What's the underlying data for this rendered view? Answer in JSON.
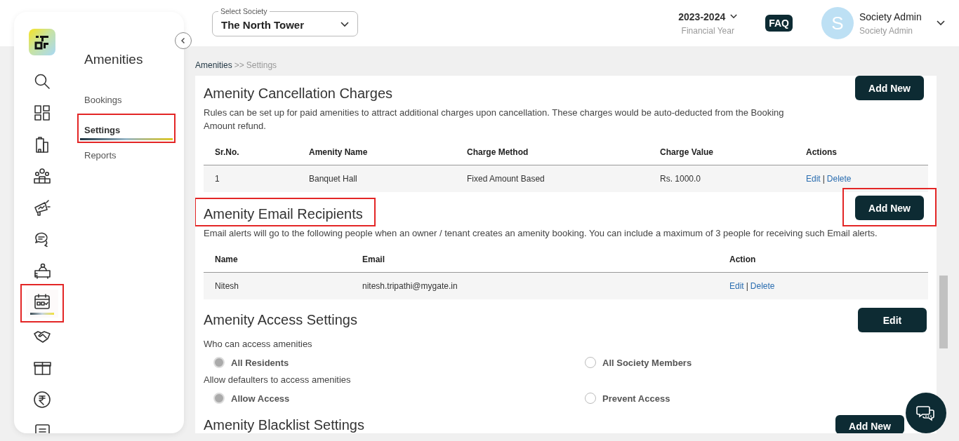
{
  "header": {
    "society_select": {
      "label": "Select Society",
      "value": "The North Tower"
    },
    "financial_year": {
      "value": "2023-2024",
      "label": "Financial Year"
    },
    "faq": "FAQ",
    "user": {
      "initial": "S",
      "name": "Society Admin",
      "role": "Society Admin"
    }
  },
  "rail": {
    "items": [
      {
        "selected": false,
        "highlighted": false
      },
      {
        "selected": false,
        "highlighted": false
      },
      {
        "selected": false,
        "highlighted": false
      },
      {
        "selected": false,
        "highlighted": false
      },
      {
        "selected": false,
        "highlighted": false
      },
      {
        "selected": false,
        "highlighted": false
      },
      {
        "selected": false,
        "highlighted": false
      },
      {
        "selected": true,
        "highlighted": true
      },
      {
        "selected": false,
        "highlighted": false
      },
      {
        "selected": false,
        "highlighted": false
      },
      {
        "selected": false,
        "highlighted": false
      },
      {
        "selected": false,
        "highlighted": false
      }
    ]
  },
  "submenu": {
    "title": "Amenities",
    "items": [
      {
        "label": "Bookings",
        "selected": false,
        "highlighted": false
      },
      {
        "label": "Settings",
        "selected": true,
        "highlighted": true
      },
      {
        "label": "Reports",
        "selected": false,
        "highlighted": false
      }
    ]
  },
  "breadcrumb": {
    "parent": "Amenities",
    "separator": ">>",
    "current": "Settings"
  },
  "sections": [
    {
      "kind": "table",
      "title": "Amenity Cancellation Charges",
      "highlighted": false,
      "button": {
        "label": "Add New",
        "highlighted": false
      },
      "description": "Rules can be set up for paid amenities to attract additional charges upon cancellation. These charges would be auto-deducted from the Booking Amount refund.",
      "narrow": true,
      "columns": [
        "Sr.No.",
        "Amenity Name",
        "Charge Method",
        "Charge Value",
        "Actions"
      ],
      "rows": [
        {
          "cells": [
            "1",
            "Banquet Hall",
            "Fixed Amount Based",
            "Rs. 1000.0"
          ],
          "actions": [
            "Edit",
            "Delete"
          ],
          "separator": "|"
        }
      ]
    },
    {
      "kind": "table",
      "title": "Amenity Email Recipients",
      "highlighted": true,
      "button": {
        "label": "Add New",
        "highlighted": true
      },
      "description": "Email alerts will go to the following people when an owner / tenant creates an amenity booking. You can include a maximum of 3 people for receiving such Email alerts.",
      "narrow": false,
      "columns": [
        "Name",
        "Email",
        "Action"
      ],
      "rows": [
        {
          "cells": [
            "Nitesh",
            "nitesh.tripathi@mygate.in"
          ],
          "actions": [
            "Edit",
            "Delete"
          ],
          "separator": "|"
        }
      ]
    },
    {
      "kind": "options",
      "title": "Amenity Access Settings",
      "highlighted": false,
      "button": {
        "label": "Edit",
        "highlighted": false
      },
      "groups": [
        {
          "label": "Who can access amenities",
          "options": [
            {
              "label": "All Residents",
              "selected": true
            },
            {
              "label": "All Society Members",
              "selected": false
            }
          ]
        },
        {
          "label": "Allow defaulters to access amenities",
          "options": [
            {
              "label": "Allow Access",
              "selected": true
            },
            {
              "label": "Prevent Access",
              "selected": false
            }
          ]
        }
      ]
    },
    {
      "kind": "heading",
      "title": "Amenity Blacklist Settings",
      "highlighted": false,
      "button": {
        "label": "Add New",
        "highlighted": false
      }
    }
  ]
}
